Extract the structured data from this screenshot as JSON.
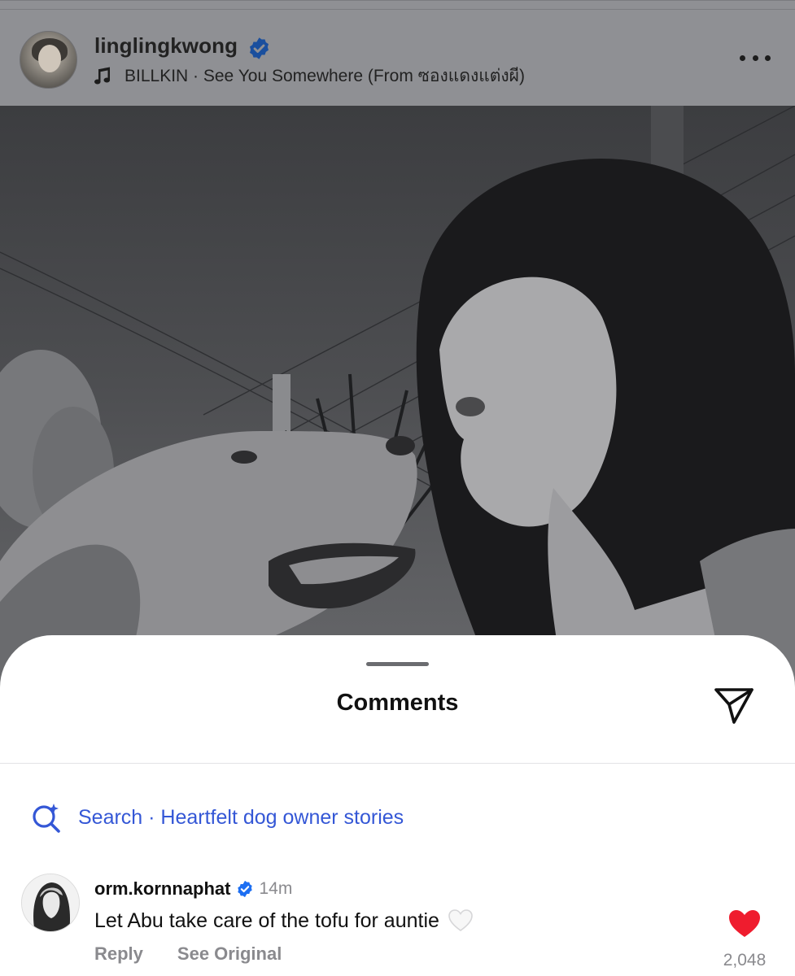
{
  "post": {
    "username": "linglingkwong",
    "music": "BILLKIN · See You Somewhere (From ซองแดงแต่งผี)"
  },
  "comments_sheet": {
    "title": "Comments",
    "search_text": "Search · Heartfelt dog owner stories",
    "comment": {
      "username": "orm.kornnaphat",
      "time": "14m",
      "text": "Let Abu take care of the tofu for auntie",
      "reply_label": "Reply",
      "see_original_label": "See Original",
      "like_count": "2,048",
      "liked": true
    }
  },
  "colors": {
    "link_blue": "#3457d6",
    "verified_blue": "#1d6ff2",
    "heart_red": "#ef1c2e",
    "dim_overlay": "#8f9094"
  },
  "icons": [
    "verified-badge-icon",
    "music-note-icon",
    "more-options-icon",
    "share-send-icon",
    "ai-search-icon",
    "white-heart-icon",
    "heart-filled-icon"
  ]
}
